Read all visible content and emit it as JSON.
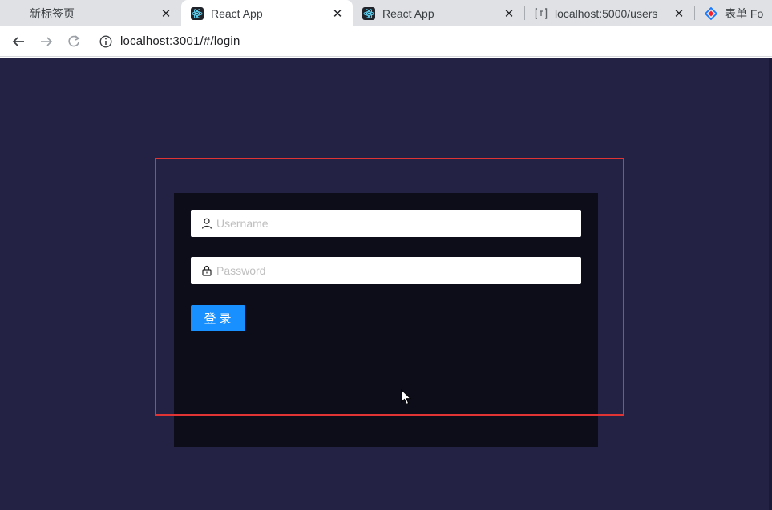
{
  "browser": {
    "tabs": [
      {
        "title": "新标签页",
        "icon": "new-tab",
        "close": "✕"
      },
      {
        "title": "React App",
        "icon": "react-icon",
        "close": "✕"
      },
      {
        "title": "React App",
        "icon": "react-icon",
        "close": "✕"
      },
      {
        "title": "localhost:5000/users",
        "icon": "code-brackets-icon",
        "close": "✕"
      },
      {
        "title": "表单 Form",
        "icon": "antd-logo-icon",
        "close": ""
      }
    ],
    "address_url": "localhost:3001/#/login"
  },
  "login": {
    "username_placeholder": "Username",
    "password_placeholder": "Password",
    "submit_label": "登录"
  },
  "colors": {
    "page_bg": "#232244",
    "panel_bg": "#0c0d19",
    "primary": "#1890ff",
    "highlight": "#e03434"
  }
}
